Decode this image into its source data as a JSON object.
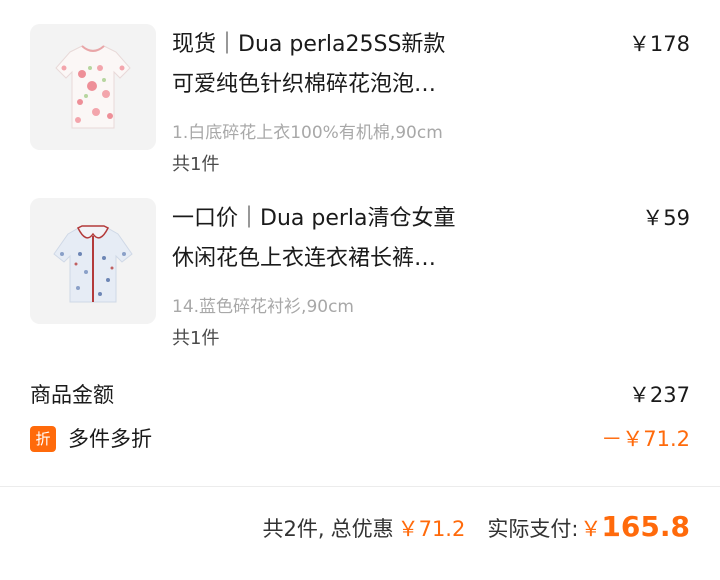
{
  "items": [
    {
      "title_line1": "现货｜Dua perla25SS新款",
      "title_line2": "可爱纯色针织棉碎花泡泡…",
      "spec": "1.白底碎花上衣100%有机棉,90cm",
      "quantity": "共1件",
      "price": "￥178",
      "image": "floral-tshirt-image"
    },
    {
      "title_line1": "一口价｜Dua perla清仓女童",
      "title_line2": "休闲花色上衣连衣裙长裤…",
      "spec": "14.蓝色碎花衬衫,90cm",
      "quantity": "共1件",
      "price": "￥59",
      "image": "blue-floral-shirt-image"
    }
  ],
  "summary": {
    "goods_amount_label": "商品金额",
    "goods_amount_value": "￥237",
    "discount_badge": "折",
    "discount_label": "多件多折",
    "discount_value": "－￥71.2"
  },
  "footer": {
    "count": "共2件,",
    "discount_label": "总优惠",
    "discount_value": "￥71.2",
    "pay_label": "实际支付:",
    "pay_currency": "￥",
    "pay_value": "165.8"
  },
  "colors": {
    "accent": "#ff6a0b",
    "muted": "#a8a8a8"
  }
}
